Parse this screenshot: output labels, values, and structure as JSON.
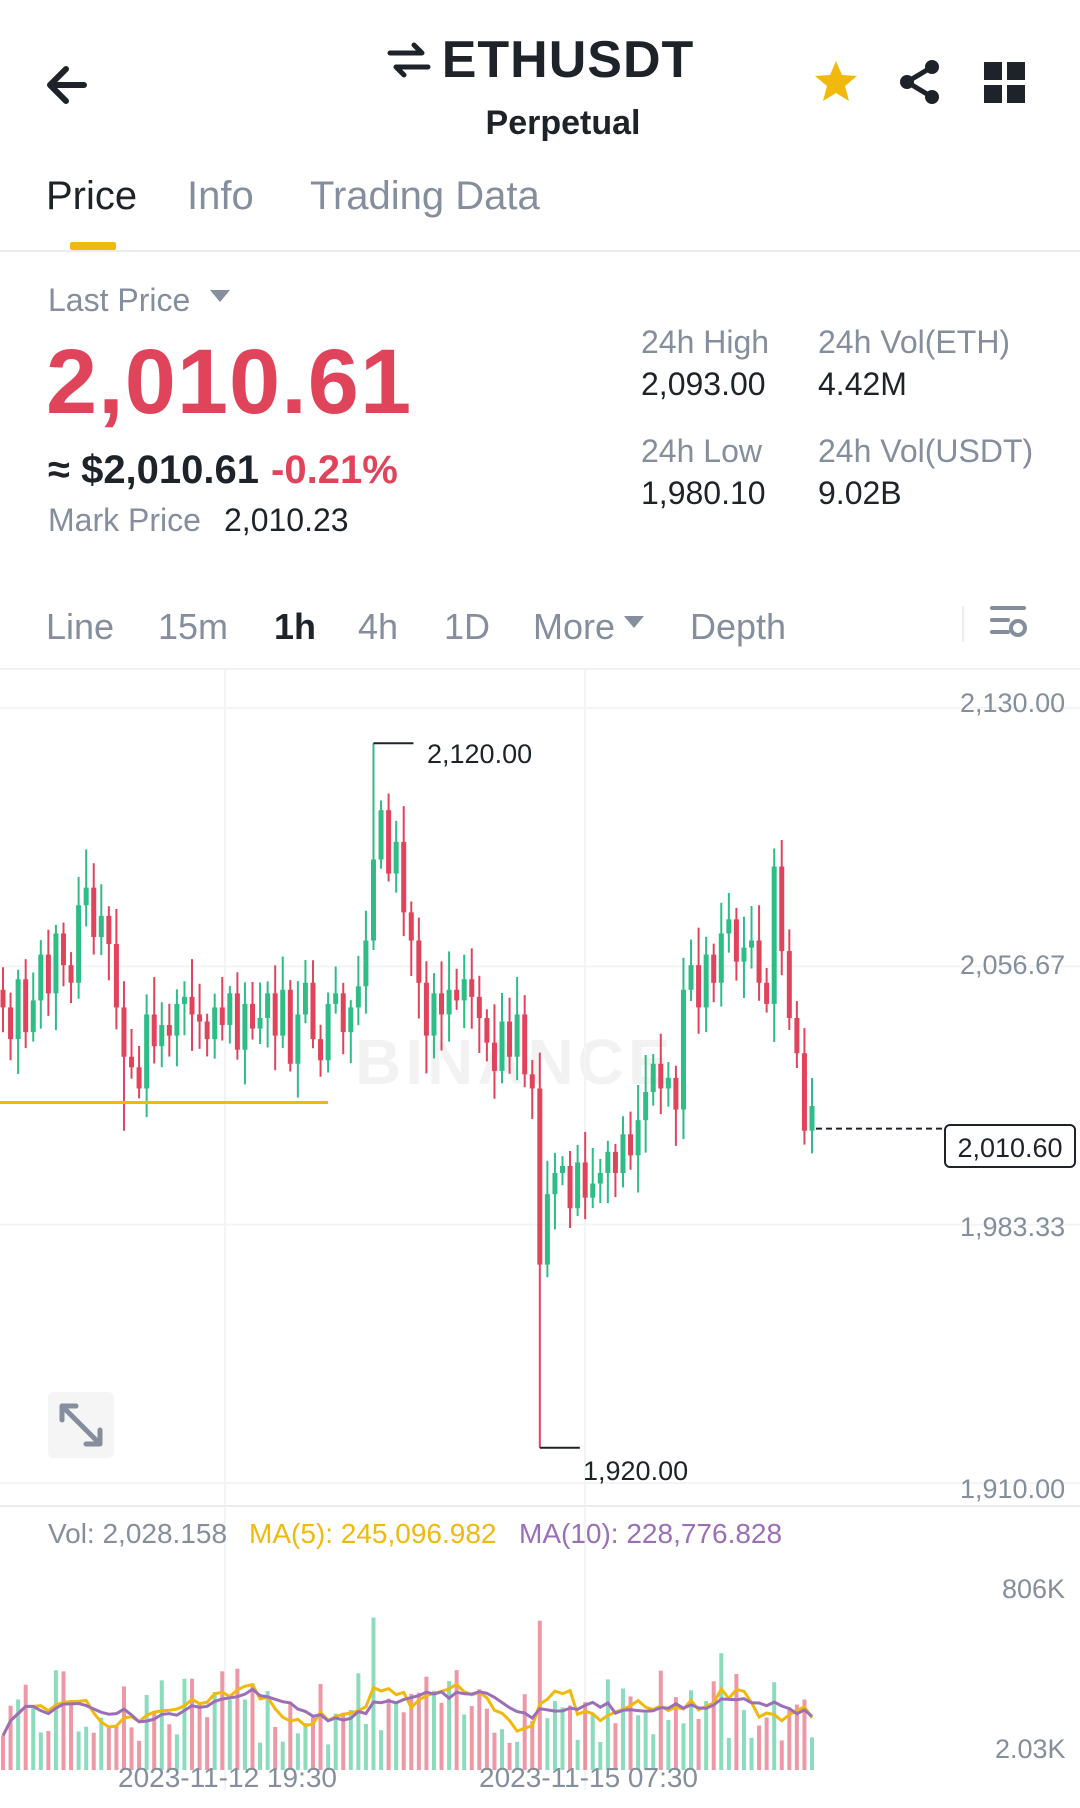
{
  "header": {
    "symbol": "ETHUSDT",
    "subtitle": "Perpetual",
    "icons": [
      "back-arrow-icon",
      "swap-icon",
      "star-icon",
      "share-icon",
      "grid-icon"
    ],
    "star_color": "#f0b90b"
  },
  "tabs": [
    {
      "label": "Price",
      "active": true
    },
    {
      "label": "Info",
      "active": false
    },
    {
      "label": "Trading Data",
      "active": false
    }
  ],
  "price": {
    "last_price_label": "Last Price",
    "last_price": "2,010.61",
    "usd_approx": "≈ $2,010.61",
    "change_pct": "-0.21%",
    "mark_price_label": "Mark Price",
    "mark_price": "2,010.23",
    "price_color": "#e0445b"
  },
  "stats": {
    "high_label": "24h High",
    "high_value": "2,093.00",
    "low_label": "24h Low",
    "low_value": "1,980.10",
    "vol_eth_label": "24h Vol(ETH)",
    "vol_eth_value": "4.42M",
    "vol_usdt_label": "24h Vol(USDT)",
    "vol_usdt_value": "9.02B"
  },
  "intervals": [
    {
      "label": "Line",
      "active": false
    },
    {
      "label": "15m",
      "active": false
    },
    {
      "label": "1h",
      "active": true
    },
    {
      "label": "4h",
      "active": false
    },
    {
      "label": "1D",
      "active": false
    },
    {
      "label": "More",
      "active": false
    },
    {
      "label": "Depth",
      "active": false
    }
  ],
  "chart_data": {
    "type": "candlestick",
    "interval": "1h",
    "price_axis_ticks": [
      "2,130.00",
      "2,056.67",
      "1,983.33",
      "1,910.00"
    ],
    "ylim": [
      1910,
      2130
    ],
    "max_label": "2,120.00",
    "min_label": "1,920.00",
    "current_price_tag": "2,010.60",
    "watermark": "BINANCE",
    "up_color": "#2ebd85",
    "down_color": "#e0445b",
    "x_labels": [
      "2023-11-12 19:30",
      "2023-11-15 07:30"
    ],
    "close_series": [
      2045,
      2036,
      2053,
      2038,
      2047,
      2060,
      2049,
      2066,
      2057,
      2052,
      2074,
      2079,
      2065,
      2071,
      2063,
      2045,
      2031,
      2028,
      2022,
      2043,
      2034,
      2040,
      2037,
      2046,
      2048,
      2043,
      2041,
      2036,
      2045,
      2040,
      2049,
      2033,
      2046,
      2039,
      2042,
      2049,
      2037,
      2050,
      2029,
      2043,
      2052,
      2036,
      2030,
      2046,
      2049,
      2038,
      2045,
      2051,
      2064,
      2087,
      2101,
      2083,
      2092,
      2072,
      2064,
      2052,
      2037,
      2049,
      2043,
      2050,
      2047,
      2053,
      2048,
      2042,
      2035,
      2027,
      2041,
      2031,
      2043,
      2026,
      2022,
      1972,
      1992,
      1998,
      2000,
      1988,
      2001,
      1991,
      1995,
      1998,
      2004,
      1998,
      2009,
      2003,
      2013,
      2021,
      2029,
      2022,
      2025,
      2016,
      2050,
      2057,
      2045,
      2060,
      2052,
      2066,
      2070,
      2058,
      2062,
      2064,
      2052,
      2046,
      2085,
      2061,
      2042,
      2032,
      2010,
      2017
    ]
  },
  "volume": {
    "vol_label": "Vol: 2,028.158",
    "ma5_label": "MA(5): 245,096.982",
    "ma10_label": "MA(10): 228,776.828",
    "ma5_color": "#f0b90b",
    "ma10_color": "#9b6fb8",
    "axis_top": "806K",
    "axis_bottom": "2.03K"
  }
}
